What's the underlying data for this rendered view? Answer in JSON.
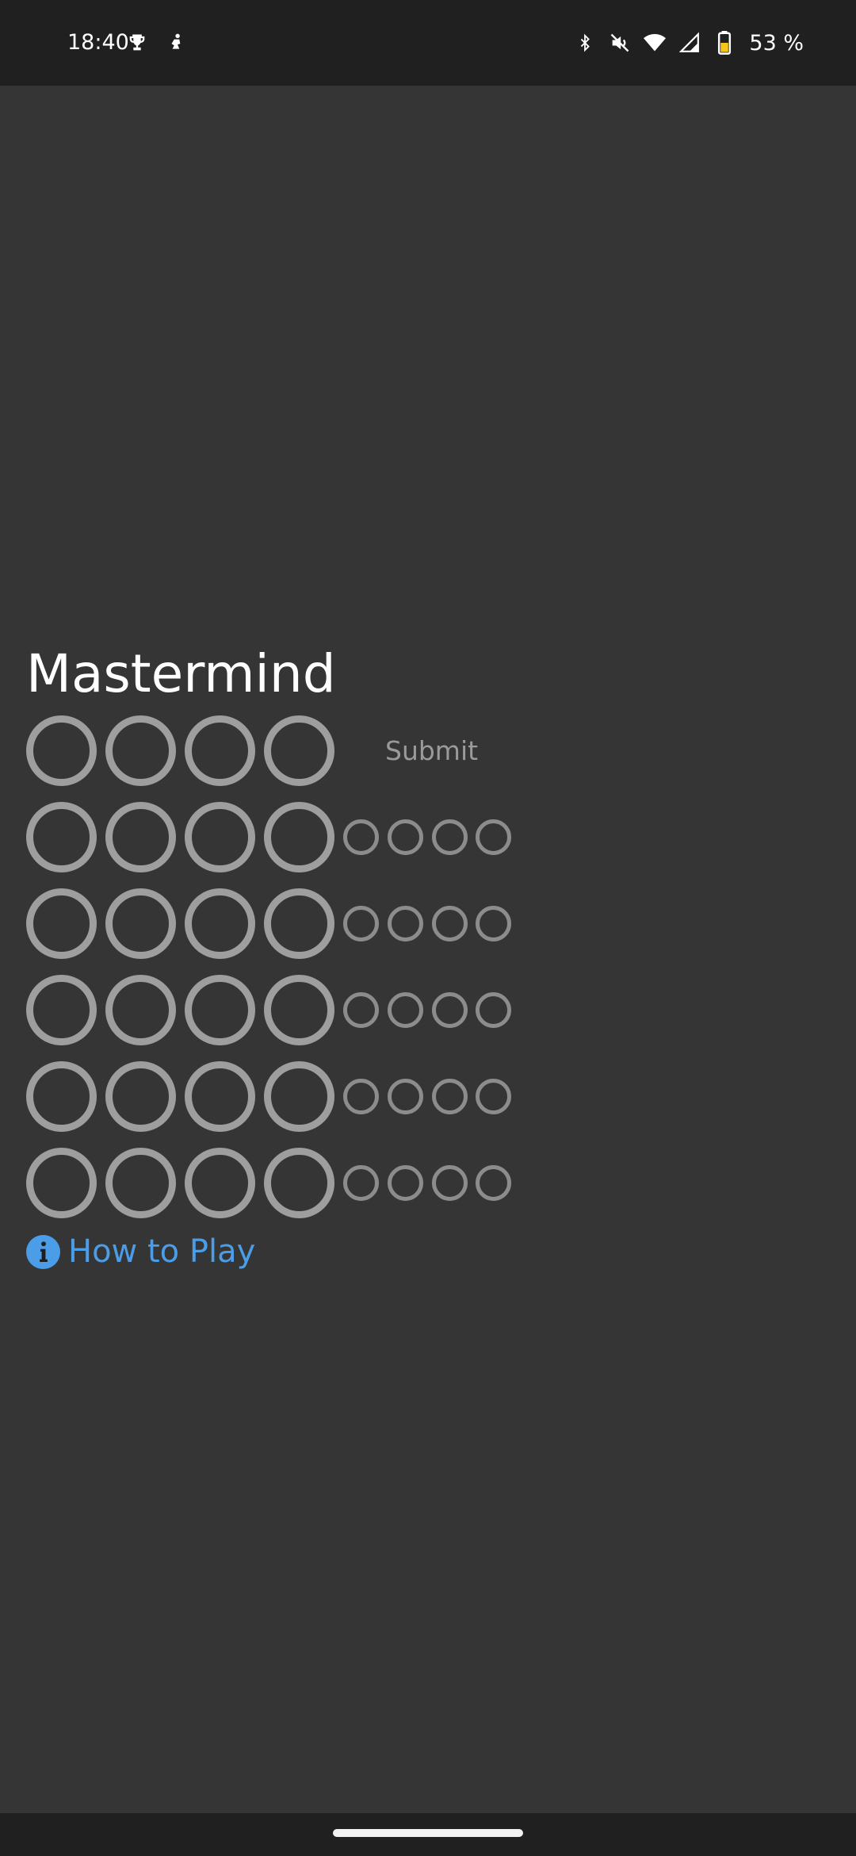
{
  "status_bar": {
    "time": "18:40",
    "battery_text": "53 %",
    "icons": [
      "trophy-icon",
      "figure-icon",
      "bluetooth-icon",
      "mute-icon",
      "wifi-icon",
      "signal-icon",
      "battery-icon"
    ]
  },
  "game": {
    "title": "Mastermind",
    "submit_label": "Submit",
    "how_to_play_label": "How to Play",
    "rows": 6,
    "pegs_per_row": 4,
    "hints_per_row": 4
  },
  "colors": {
    "background": "#353535",
    "status_bar": "#202020",
    "peg_outline": "#9e9e9e",
    "hint_outline": "#8c8c8c",
    "link": "#4a9de6",
    "submit_text": "#9a9a9a"
  }
}
